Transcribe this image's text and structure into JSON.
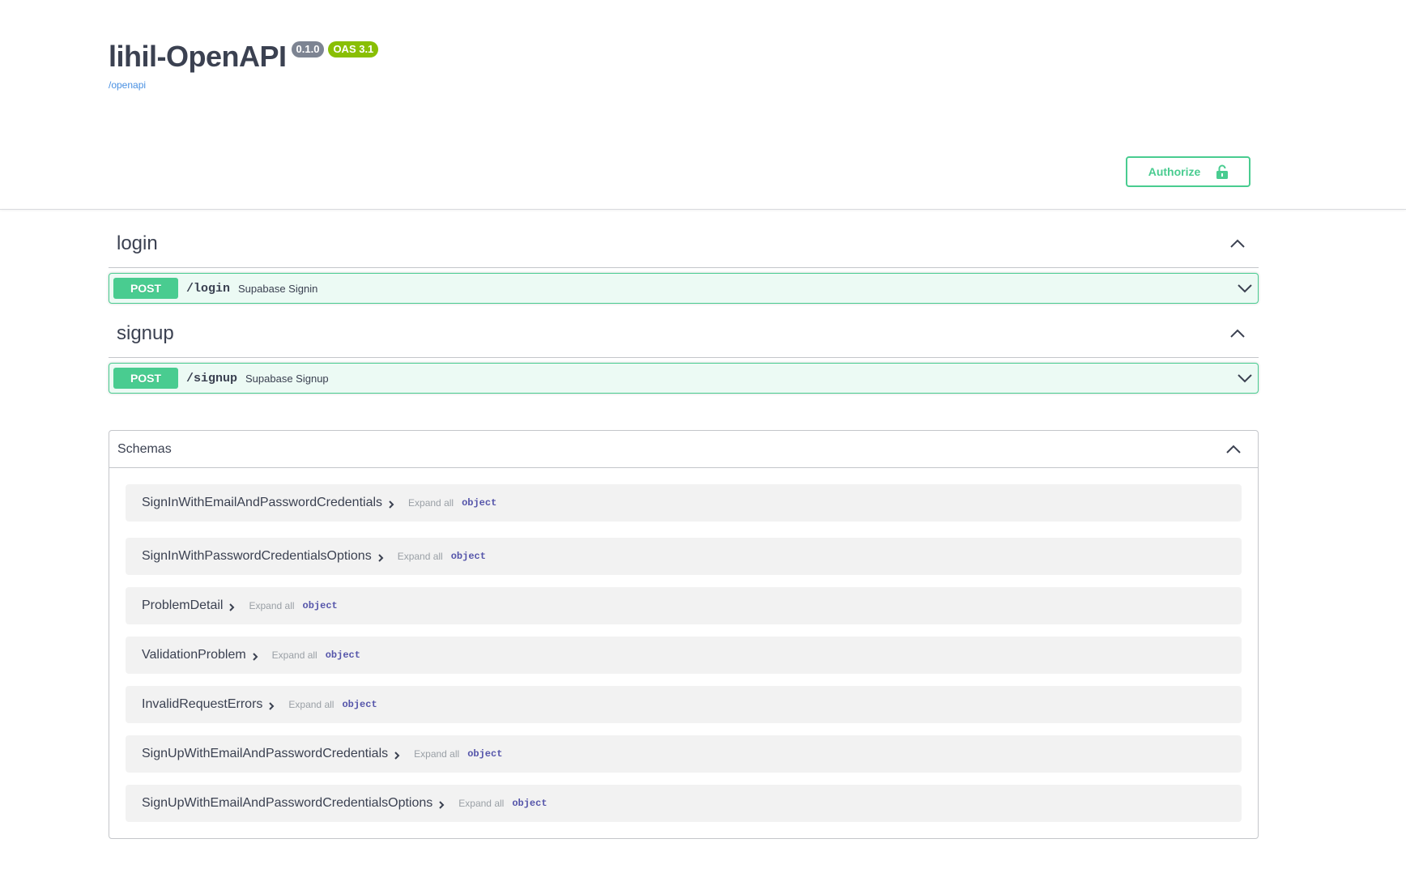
{
  "info": {
    "title": "lihil-OpenAPI",
    "version": "0.1.0",
    "oas_version": "OAS 3.1",
    "spec_link": "/openapi"
  },
  "authorize": {
    "label": "Authorize"
  },
  "tags": [
    {
      "name": "login",
      "operations": [
        {
          "method": "POST",
          "path": "/login",
          "summary": "Supabase Signin"
        }
      ]
    },
    {
      "name": "signup",
      "operations": [
        {
          "method": "POST",
          "path": "/signup",
          "summary": "Supabase Signup"
        }
      ]
    }
  ],
  "schemas": {
    "title": "Schemas",
    "expand_label": "Expand all",
    "items": [
      {
        "name": "SignInWithEmailAndPasswordCredentials",
        "type": "object"
      },
      {
        "name": "SignInWithPasswordCredentialsOptions",
        "type": "object"
      },
      {
        "name": "ProblemDetail",
        "type": "object"
      },
      {
        "name": "ValidationProblem",
        "type": "object"
      },
      {
        "name": "InvalidRequestErrors",
        "type": "object"
      },
      {
        "name": "SignUpWithEmailAndPasswordCredentials",
        "type": "object"
      },
      {
        "name": "SignUpWithEmailAndPasswordCredentialsOptions",
        "type": "object"
      }
    ]
  },
  "colors": {
    "post_green": "#49cc90",
    "text": "#3b4151",
    "version_badge": "#7d8492",
    "oas_badge": "#89bf04",
    "link": "#4990e2",
    "type_blue": "#5555aa"
  }
}
